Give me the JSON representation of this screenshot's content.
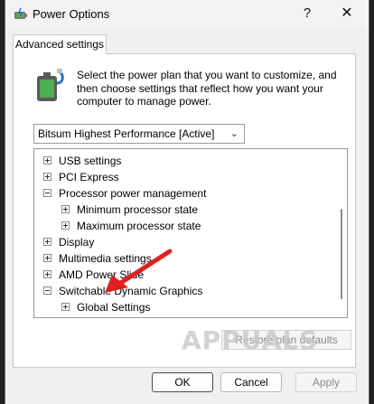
{
  "window": {
    "title": "Power Options",
    "help_glyph": "?",
    "close_glyph": "✕"
  },
  "tab": {
    "label": "Advanced settings"
  },
  "description": "Select the power plan that you want to customize, and then choose settings that reflect how you want your computer to manage power.",
  "plan_select": {
    "value": "Bitsum Highest Performance [Active]"
  },
  "tree": {
    "items": [
      {
        "label": "USB settings",
        "expander": "plus"
      },
      {
        "label": "PCI Express",
        "expander": "plus"
      },
      {
        "label": "Processor power management",
        "expander": "minus"
      },
      {
        "label": "Minimum processor state",
        "expander": "plus"
      },
      {
        "label": "Maximum processor state",
        "expander": "plus"
      },
      {
        "label": "Display",
        "expander": "plus"
      },
      {
        "label": "Multimedia settings",
        "expander": "plus"
      },
      {
        "label": "AMD Power Slide",
        "expander": "plus"
      },
      {
        "label": "Switchable Dynamic Graphics",
        "expander": "minus"
      },
      {
        "label": "Global Settings",
        "expander": "plus"
      }
    ]
  },
  "buttons": {
    "restore": "Restore plan defaults",
    "ok": "OK",
    "cancel": "Cancel",
    "apply": "Apply"
  },
  "watermark": "APPUALS",
  "colors": {
    "arrow": "#e02020",
    "dialog_bg": "#f0f0f0",
    "panel_bg": "#ffffff"
  }
}
